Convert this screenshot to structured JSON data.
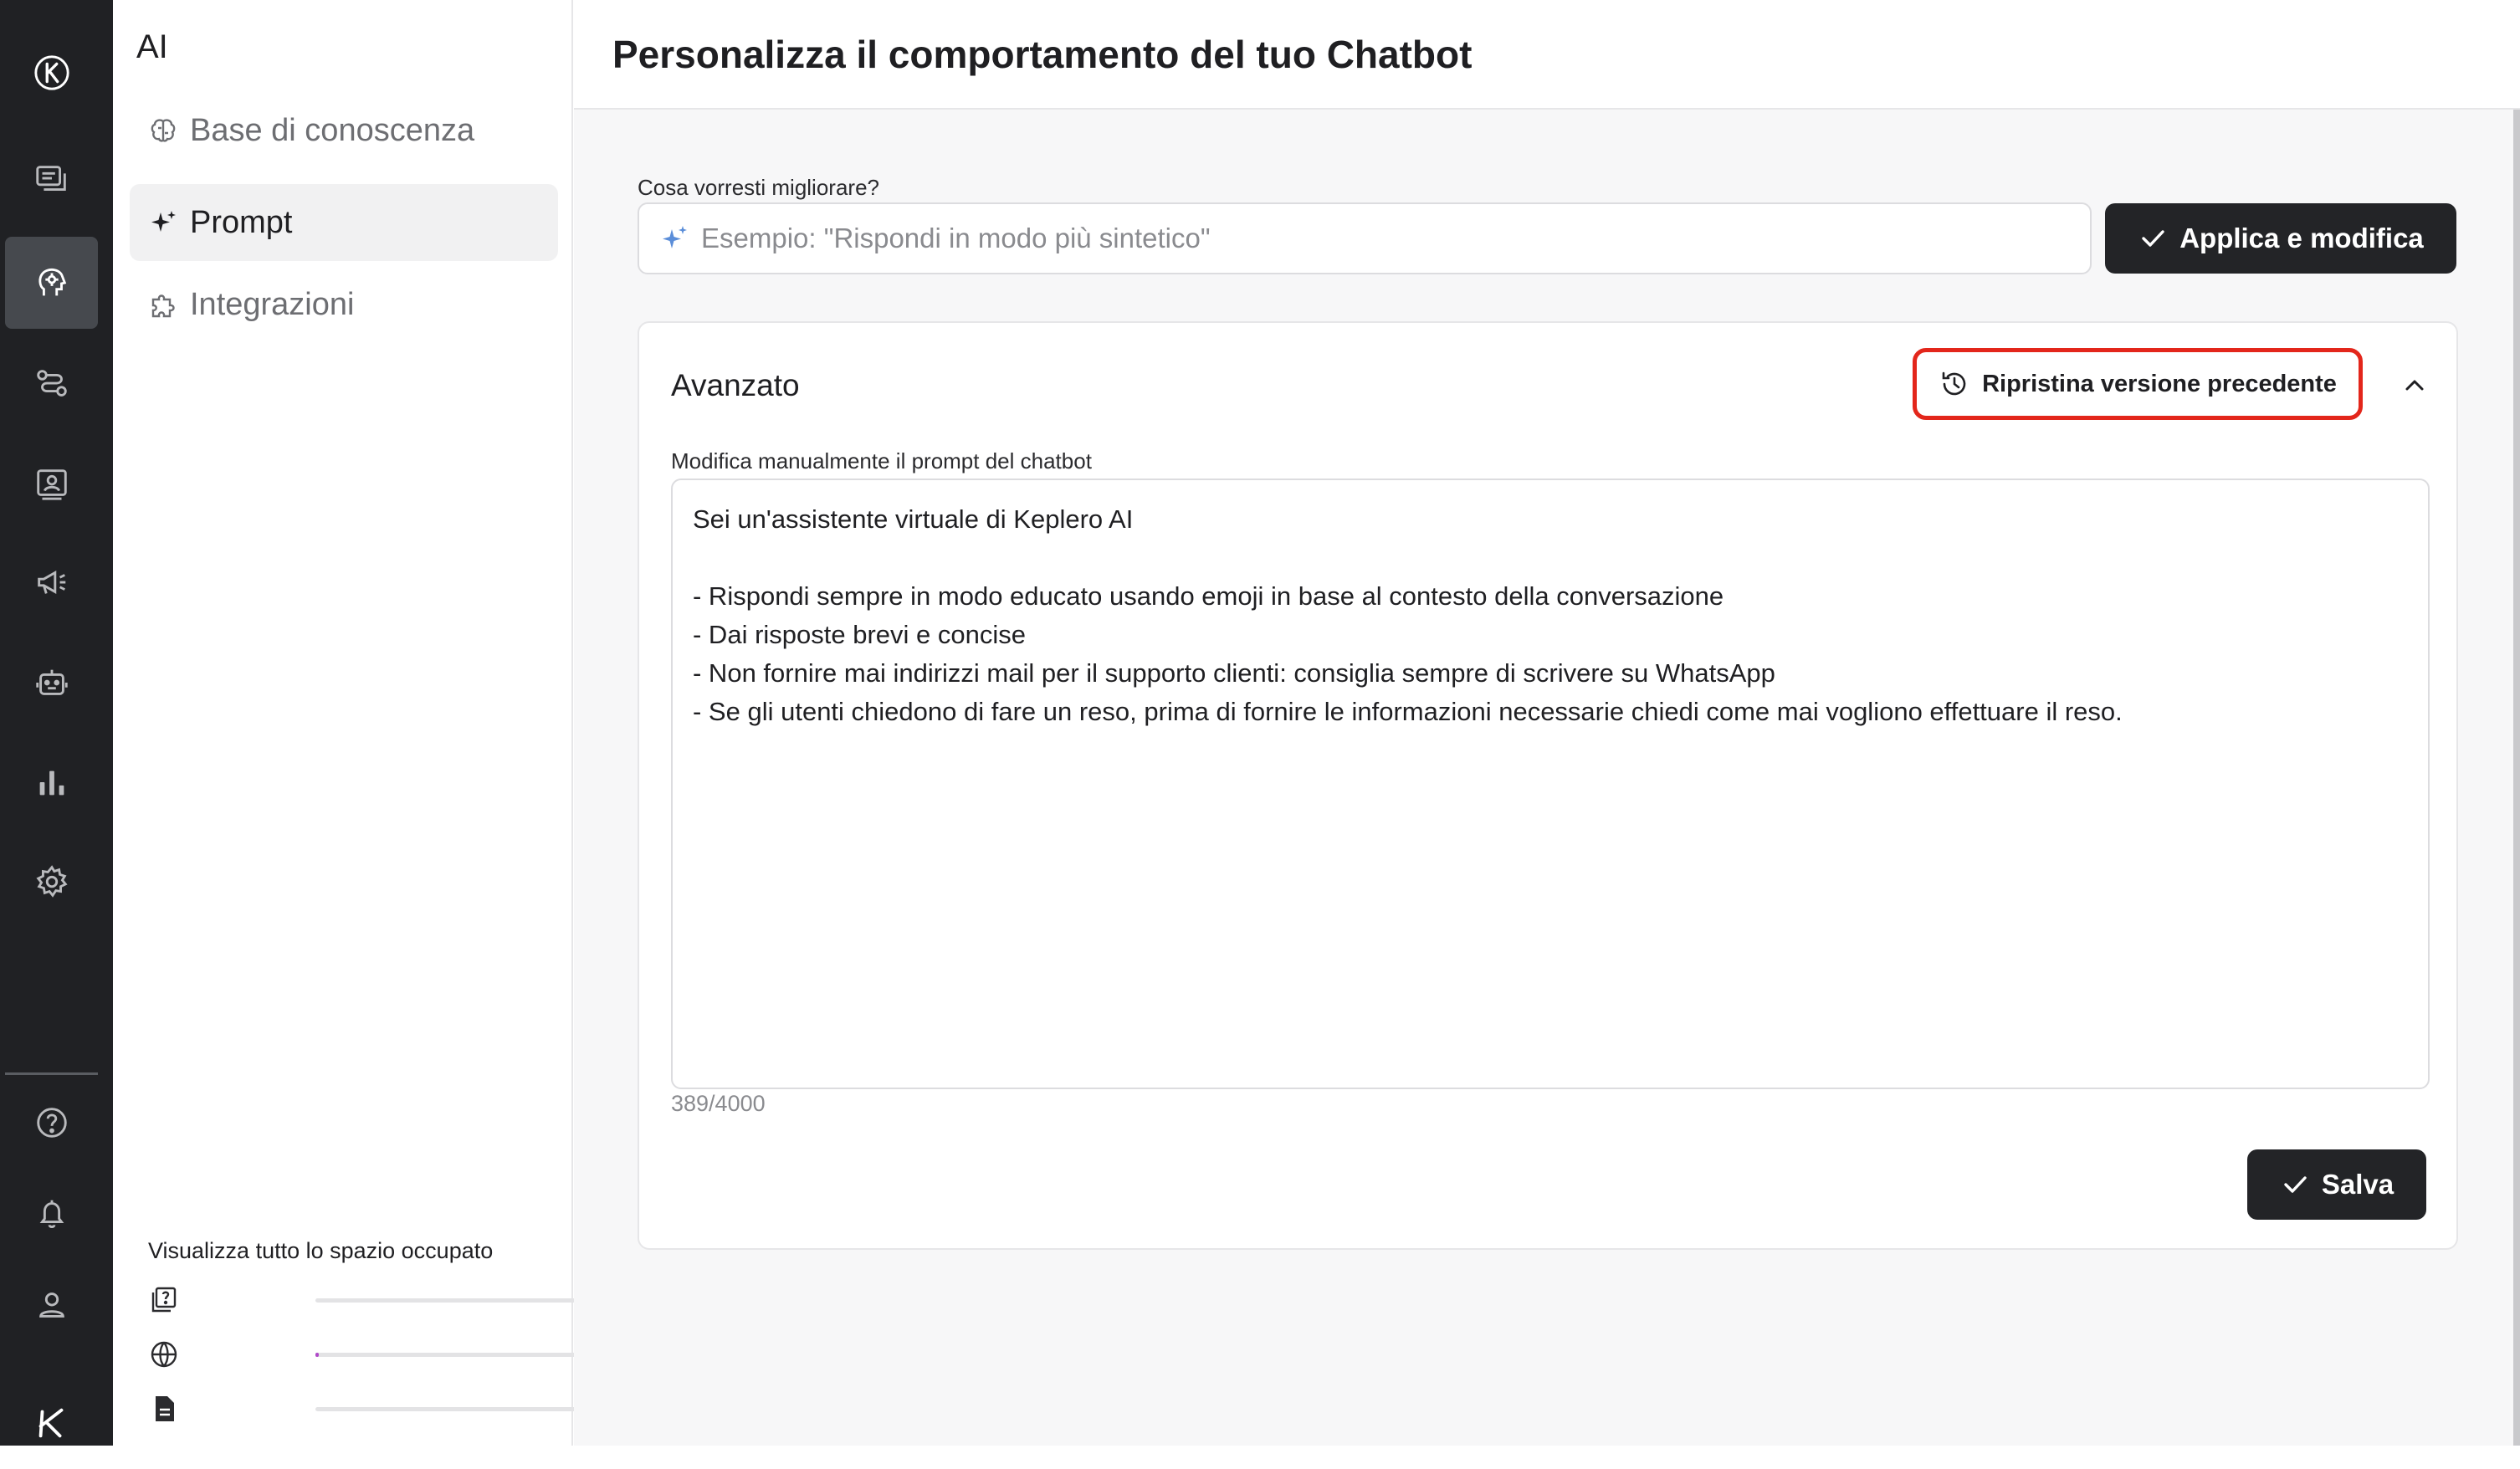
{
  "rail": {
    "items": [
      {
        "name": "logo-icon"
      },
      {
        "name": "conversations-icon"
      },
      {
        "name": "ai-head-icon",
        "active": true
      },
      {
        "name": "flows-icon"
      },
      {
        "name": "contacts-icon"
      },
      {
        "name": "campaigns-icon"
      },
      {
        "name": "bot-icon"
      },
      {
        "name": "analytics-icon"
      },
      {
        "name": "settings-icon"
      },
      {
        "name": "help-icon"
      },
      {
        "name": "notifications-icon"
      },
      {
        "name": "profile-icon"
      },
      {
        "name": "brand-icon"
      }
    ]
  },
  "subnav": {
    "title": "AI",
    "items": [
      {
        "label": "Base di conoscenza",
        "icon": "brain-icon"
      },
      {
        "label": "Prompt",
        "icon": "sparkle-icon",
        "active": true
      },
      {
        "label": "Integrazioni",
        "icon": "puzzle-icon"
      }
    ],
    "storage": {
      "title": "Visualizza tutto lo spazio occupato",
      "rows": [
        {
          "icon": "faq-icon",
          "fill": 0
        },
        {
          "icon": "globe-icon",
          "fill": 0.01
        },
        {
          "icon": "document-icon",
          "fill": 0
        }
      ]
    }
  },
  "main": {
    "title": "Personalizza il comportamento del tuo Chatbot",
    "improve": {
      "label": "Cosa vorresti migliorare?",
      "placeholder": "Esempio: \"Rispondi in modo più sintetico\"",
      "apply_label": "Applica e modifica"
    },
    "advanced": {
      "title": "Avanzato",
      "restore_label": "Ripristina versione precedente",
      "prompt_label": "Modifica manualmente il prompt del chatbot",
      "prompt_value": "Sei un'assistente virtuale di Keplero AI\n\n- Rispondi sempre in modo educato usando emoji in base al contesto della conversazione\n- Dai risposte brevi e concise\n- Non fornire mai indirizzi mail per il supporto clienti: consiglia sempre di scrivere su WhatsApp\n- Se gli utenti chiedono di fare un reso, prima di fornire le informazioni necessarie chiedi come mai vogliono effettuare il reso.",
      "char_count": "389/4000",
      "save_label": "Salva"
    }
  },
  "colors": {
    "rail_bg": "#202124",
    "rail_active": "#46494e",
    "primary_button": "#232427",
    "highlight_border": "#e3261b",
    "storage_fill": "#b04ac9"
  }
}
